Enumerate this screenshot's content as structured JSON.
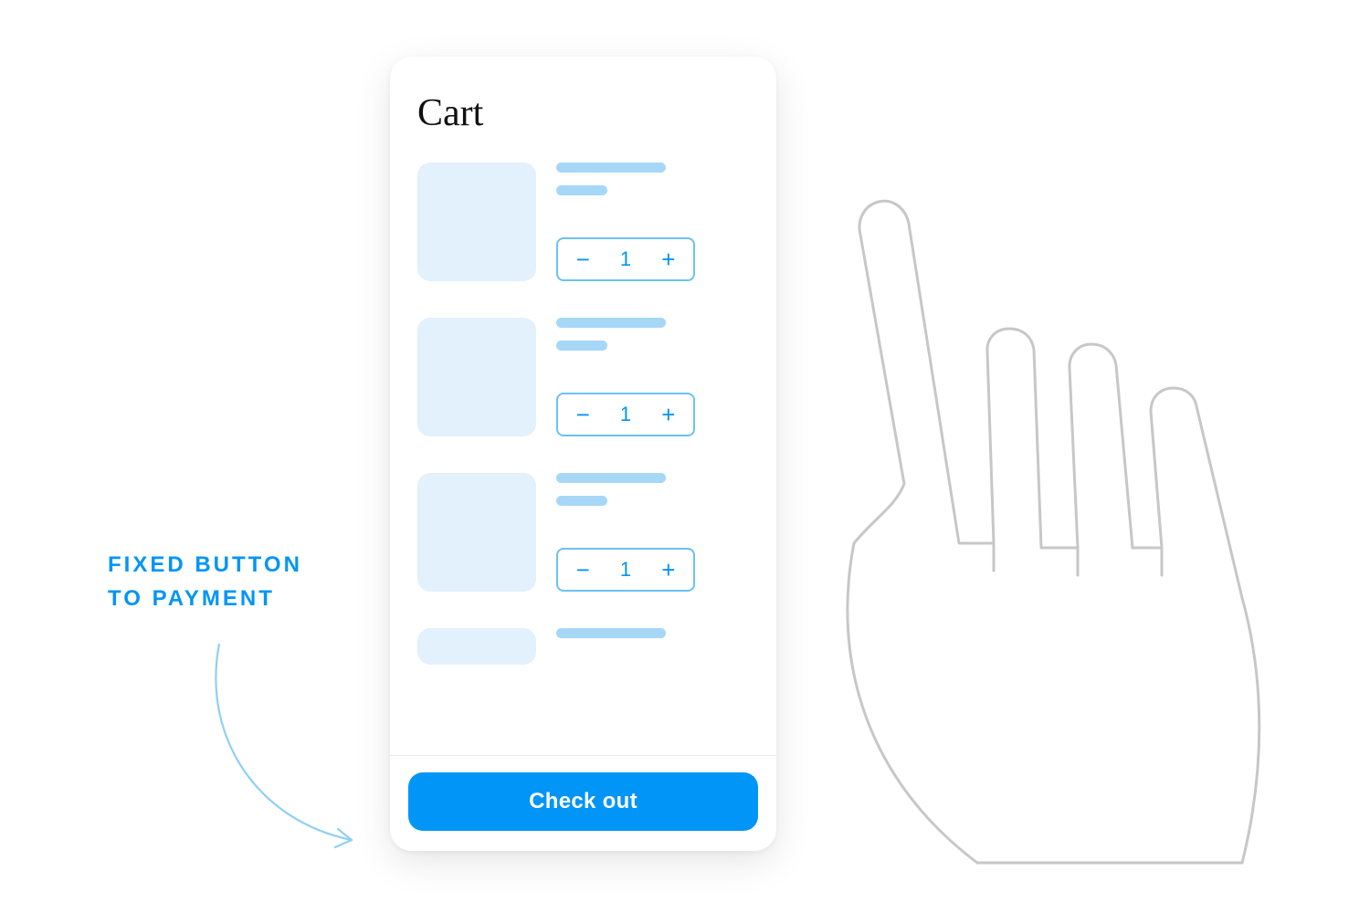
{
  "annotation": {
    "line1": "Fixed button",
    "line2": "to payment"
  },
  "phone": {
    "title": "Cart",
    "items": [
      {
        "quantity": "1"
      },
      {
        "quantity": "1"
      },
      {
        "quantity": "1"
      }
    ],
    "checkout_label": "Check out"
  },
  "colors": {
    "accent": "#0095f6",
    "light": "#e2f1fb",
    "skeleton": "#a6d7f7",
    "stroke": "#6bc1f2",
    "hand": "#c7c7c7"
  },
  "icons": {
    "minus": "−",
    "plus": "+"
  }
}
